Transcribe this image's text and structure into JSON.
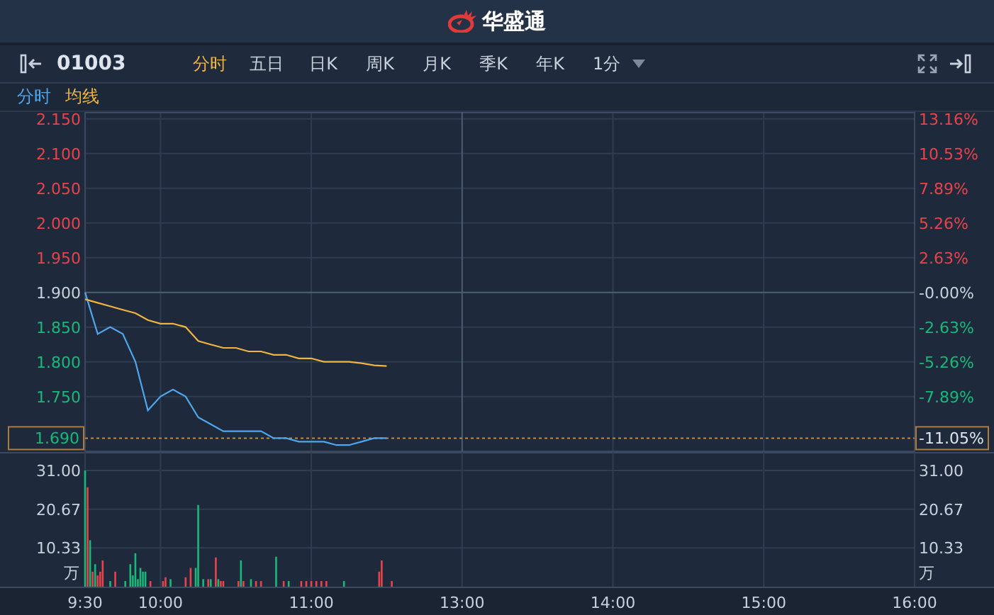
{
  "header": {
    "brand": "华盛通"
  },
  "toolbar": {
    "code": "01003",
    "tabs": [
      {
        "label": "分时",
        "selected": true
      },
      {
        "label": "五日",
        "selected": false
      },
      {
        "label": "日K",
        "selected": false
      },
      {
        "label": "周K",
        "selected": false
      },
      {
        "label": "月K",
        "selected": false
      },
      {
        "label": "季K",
        "selected": false
      },
      {
        "label": "年K",
        "selected": false
      }
    ],
    "interval": "1分"
  },
  "price_chart": {
    "chart_data": {
      "type": "line",
      "grid": true,
      "categories": [
        null,
        null,
        null,
        null,
        null,
        null,
        null,
        null,
        null,
        null,
        null,
        null,
        null,
        null,
        null,
        null,
        null,
        null,
        null,
        null,
        null,
        null,
        null,
        null,
        null,
        null,
        null,
        null,
        null,
        null,
        null,
        null,
        null,
        null,
        null,
        null,
        null,
        null,
        null,
        null,
        null,
        null,
        null,
        null,
        null,
        null,
        null,
        null,
        null,
        null,
        null,
        null,
        null,
        null,
        null,
        null,
        null,
        null,
        null,
        null,
        null,
        null,
        null,
        null,
        null,
        null,
        null
      ],
      "ylim": [
        1.67,
        2.16
      ],
      "yticks": [
        {
          "value": 2.15,
          "label": "2.150"
        },
        {
          "value": 2.1,
          "label": "2.100"
        },
        {
          "value": 2.05,
          "label": "2.050"
        },
        {
          "value": 2.0,
          "label": "2.000"
        },
        {
          "value": 1.95,
          "label": "1.950"
        },
        {
          "value": 1.9,
          "label": "1.900"
        },
        {
          "value": 1.85,
          "label": "1.850"
        },
        {
          "value": 1.8,
          "label": "1.800"
        },
        {
          "value": 1.75,
          "label": "1.750"
        }
      ],
      "ref_lines": [
        {
          "axis": "y",
          "value": 1.9
        },
        {
          "axis": "y",
          "value": 1.69
        }
      ],
      "series": [
        {
          "name": "分时",
          "color": "#4ea6ec",
          "values": [
            1.9,
            1.84,
            1.85,
            1.84,
            1.8,
            1.73,
            1.75,
            1.76,
            1.75,
            1.72,
            1.71,
            1.7,
            1.7,
            1.7,
            1.7,
            1.69,
            1.69,
            1.685,
            1.685,
            1.685,
            1.68,
            1.68,
            1.685,
            1.69,
            1.69,
            null,
            null,
            null,
            null,
            null,
            null,
            null,
            null,
            null,
            null,
            null,
            null,
            null,
            null,
            null,
            null,
            null,
            null,
            null,
            null,
            null,
            null,
            null,
            null,
            null,
            null,
            null,
            null,
            null,
            null,
            null,
            null,
            null,
            null,
            null,
            null,
            null,
            null,
            null,
            null,
            null,
            null
          ]
        },
        {
          "name": "均线",
          "color": "#f2b441",
          "values": [
            1.89,
            1.885,
            1.88,
            1.875,
            1.87,
            1.86,
            1.855,
            1.855,
            1.85,
            1.83,
            1.825,
            1.82,
            1.82,
            1.815,
            1.815,
            1.81,
            1.81,
            1.805,
            1.805,
            1.8,
            1.8,
            1.8,
            1.798,
            1.795,
            1.794,
            null,
            null,
            null,
            null,
            null,
            null,
            null,
            null,
            null,
            null,
            null,
            null,
            null,
            null,
            null,
            null,
            null,
            null,
            null,
            null,
            null,
            null,
            null,
            null,
            null,
            null,
            null,
            null,
            null,
            null,
            null,
            null,
            null,
            null,
            null,
            null,
            null,
            null,
            null,
            null,
            null,
            null
          ]
        }
      ]
    },
    "right_axis": [
      {
        "label": "13.16%",
        "color": "#e8434b"
      },
      {
        "label": "10.53%",
        "color": "#e8434b"
      },
      {
        "label": "7.89%",
        "color": "#e8434b"
      },
      {
        "label": "5.26%",
        "color": "#e8434b"
      },
      {
        "label": "2.63%",
        "color": "#e8434b"
      },
      {
        "label": "-0.00%",
        "color": "#c8d0dc"
      },
      {
        "label": "-2.63%",
        "color": "#19b87a"
      },
      {
        "label": "-5.26%",
        "color": "#19b87a"
      },
      {
        "label": "-7.89%",
        "color": "#19b87a"
      }
    ],
    "current": {
      "price": "1.690",
      "change": "-11.05%",
      "color": "#19b87a"
    }
  },
  "volume_chart": {
    "chart_data": {
      "type": "bar",
      "grid": true,
      "stacked": true,
      "ylabel": "万",
      "ylim": [
        0,
        31
      ],
      "categories": [
        "9:30",
        null,
        null,
        null,
        null,
        null,
        null,
        null,
        null,
        null,
        null,
        null,
        null,
        null,
        null,
        null,
        null,
        null,
        null,
        null,
        null,
        null,
        null,
        null,
        null,
        null,
        null,
        null,
        null,
        null,
        "10:00",
        null,
        null,
        null,
        null,
        null,
        null,
        null,
        null,
        null,
        null,
        null,
        null,
        null,
        null,
        null,
        null,
        null,
        null,
        null,
        null,
        null,
        null,
        null,
        null,
        null,
        null,
        null,
        null,
        null,
        null,
        null,
        null,
        null,
        null,
        null,
        null,
        null,
        null,
        null,
        null,
        null,
        null,
        null,
        null,
        null,
        null,
        null,
        null,
        null,
        null,
        null,
        null,
        null,
        null,
        null,
        null,
        null,
        null,
        null,
        "11:00",
        null,
        null,
        null,
        null,
        null,
        null,
        null,
        null,
        null,
        null,
        null,
        null,
        null,
        null,
        null,
        null,
        null,
        null,
        null,
        null,
        null,
        null,
        null,
        null,
        null,
        null,
        null,
        null,
        null,
        null,
        null,
        null,
        null,
        null,
        null,
        null,
        null,
        null,
        null,
        null,
        null,
        null,
        null,
        null,
        null,
        null,
        null,
        null,
        null,
        null,
        null,
        null,
        null,
        null,
        null,
        null,
        null,
        null,
        null,
        "13:00",
        null,
        null,
        null,
        null,
        null,
        null,
        null,
        null,
        null,
        null,
        null,
        null,
        null,
        null,
        null,
        null,
        null,
        null,
        null,
        null,
        null,
        null,
        null,
        null,
        null,
        null,
        null,
        null,
        null,
        null,
        null,
        null,
        null,
        null,
        null,
        null,
        null,
        null,
        null,
        null,
        null,
        null,
        null,
        null,
        null,
        null,
        null,
        null,
        null,
        null,
        null,
        null,
        null,
        null,
        null,
        null,
        null,
        null,
        null,
        "14:00",
        null,
        null,
        null,
        null,
        null,
        null,
        null,
        null,
        null,
        null,
        null,
        null,
        null,
        null,
        null,
        null,
        null,
        null,
        null,
        null,
        null,
        null,
        null,
        null,
        null,
        null,
        null,
        null,
        null,
        null,
        null,
        null,
        null,
        null,
        null,
        null,
        null,
        null,
        null,
        null,
        null,
        null,
        null,
        null,
        null,
        null,
        null,
        null,
        null,
        null,
        null,
        null,
        null,
        null,
        null,
        null,
        null,
        null,
        null,
        "15:00",
        null,
        null,
        null,
        null,
        null,
        null,
        null,
        null,
        null,
        null,
        null,
        null,
        null,
        null,
        null,
        null,
        null,
        null,
        null,
        null,
        null,
        null,
        null,
        null,
        null,
        null,
        null,
        null,
        null,
        null,
        null,
        null,
        null,
        null,
        null,
        null,
        null,
        null,
        null,
        null,
        null,
        null,
        null,
        null,
        null,
        null,
        null,
        null,
        null,
        null,
        null,
        null,
        null,
        null,
        null,
        null,
        null,
        null,
        null,
        "16:00"
      ],
      "yticks": [
        {
          "value": 31,
          "label": "31.00"
        },
        {
          "value": 20.67,
          "label": "20.67"
        },
        {
          "value": 10.33,
          "label": "10.33"
        }
      ],
      "series": [
        {
          "color": "#e8434b",
          "values": [
            null,
            26.5,
            null,
            4,
            null,
            3,
            4,
            7,
            null,
            null,
            null,
            null,
            4,
            null,
            null,
            null,
            null,
            null,
            null,
            null,
            null,
            null,
            null,
            null,
            null,
            null,
            1.5,
            null,
            null,
            null,
            null,
            1.5,
            2.5,
            null,
            null,
            null,
            null,
            null,
            null,
            null,
            2.5,
            null,
            5,
            null,
            null,
            null,
            null,
            null,
            null,
            2,
            null,
            null,
            7.8,
            null,
            1.5,
            1.5,
            null,
            null,
            null,
            null,
            null,
            1.5,
            null,
            1.5,
            null,
            null,
            null,
            null,
            1.5,
            null,
            1.5,
            null,
            null,
            null,
            null,
            null,
            null,
            null,
            null,
            1.5,
            null,
            null,
            null,
            null,
            null,
            null,
            1.5,
            null,
            1.5,
            null,
            1.5,
            null,
            1.5,
            null,
            1.5,
            null,
            1.5,
            null,
            null,
            null,
            null,
            null,
            null,
            null,
            null,
            null,
            null,
            null,
            null,
            null,
            null,
            null,
            null,
            null,
            null,
            null,
            null,
            4,
            7,
            null,
            null,
            null,
            1.5,
            null,
            null,
            null,
            null,
            null,
            null,
            null,
            null,
            null,
            null,
            null,
            null,
            null,
            null,
            null,
            null,
            null,
            null,
            null,
            null,
            null,
            null,
            null,
            null,
            null,
            null,
            null,
            null,
            null,
            null,
            null,
            null,
            null,
            null,
            null,
            null,
            null,
            null,
            null,
            null,
            null,
            null,
            null,
            null,
            null,
            null,
            null,
            null,
            null,
            null,
            null,
            null,
            null,
            null,
            null,
            null,
            null,
            null,
            null,
            null,
            null,
            null,
            null,
            null,
            null,
            null,
            null,
            null,
            null,
            null,
            null,
            null,
            null,
            null,
            null,
            null,
            null,
            null,
            null,
            null,
            null,
            null,
            null,
            null,
            null,
            null,
            null,
            null,
            null,
            null,
            null,
            null,
            null,
            null,
            null,
            null,
            null,
            null,
            null,
            null,
            null,
            null,
            null,
            null,
            null,
            null,
            null,
            null,
            null,
            null,
            null,
            null,
            null,
            null,
            null,
            null,
            null,
            null,
            null,
            null,
            null,
            null,
            null,
            null,
            null,
            null,
            null,
            null,
            null,
            null,
            null,
            null,
            null,
            null,
            null,
            null,
            null,
            null,
            null,
            null,
            null,
            null,
            null,
            null,
            null,
            null,
            null,
            null,
            null,
            null,
            null,
            null,
            null,
            null,
            null,
            null,
            null,
            null,
            null,
            null,
            null,
            null,
            null,
            null,
            null,
            null,
            null,
            null,
            null,
            null,
            null,
            null,
            null,
            null,
            null,
            null,
            null,
            null,
            null,
            null,
            null,
            null,
            null,
            null,
            null,
            null,
            null,
            null,
            null,
            null,
            null,
            null,
            null,
            null,
            null,
            null,
            null,
            null,
            null,
            null,
            null,
            null,
            null,
            null,
            null,
            null,
            null,
            null
          ]
        },
        {
          "color": "#19b87a",
          "values": [
            31,
            null,
            12.4,
            null,
            6,
            null,
            null,
            null,
            null,
            null,
            1.5,
            null,
            null,
            null,
            null,
            null,
            1.5,
            null,
            6,
            3,
            8.9,
            2,
            5,
            4,
            4,
            null,
            null,
            null,
            null,
            null,
            null,
            null,
            null,
            null,
            2,
            null,
            null,
            null,
            null,
            null,
            null,
            null,
            null,
            null,
            5,
            21.8,
            null,
            2,
            null,
            null,
            2,
            null,
            null,
            2,
            null,
            null,
            null,
            null,
            null,
            null,
            null,
            null,
            7,
            null,
            null,
            null,
            2,
            null,
            null,
            null,
            null,
            null,
            null,
            null,
            null,
            null,
            8,
            null,
            null,
            null,
            null,
            1.5,
            null,
            null,
            null,
            null,
            null,
            null,
            null,
            null,
            null,
            null,
            null,
            null,
            null,
            null,
            null,
            null,
            null,
            null,
            null,
            null,
            null,
            1.5,
            null,
            null,
            null,
            null,
            null,
            null,
            null,
            null,
            null,
            null,
            null,
            null,
            null,
            null,
            null,
            null,
            null,
            null,
            null,
            null,
            null,
            null,
            null,
            null,
            null,
            null,
            null,
            null,
            null,
            null,
            null,
            null,
            null,
            null,
            null,
            null,
            null,
            null,
            null,
            null,
            null,
            null,
            null,
            null,
            null,
            null,
            null,
            null,
            null,
            null,
            null,
            null,
            null,
            null,
            null,
            null,
            null,
            null,
            null,
            null,
            null,
            null,
            null,
            null,
            null,
            null,
            null,
            null,
            null,
            null,
            null,
            null,
            null,
            null,
            null,
            null,
            null,
            null,
            null,
            null,
            null,
            null,
            null,
            null,
            null,
            null,
            null,
            null,
            null,
            null,
            null,
            null,
            null,
            null,
            null,
            null,
            null,
            null,
            null,
            null,
            null,
            null,
            null,
            null,
            null,
            null,
            null,
            null,
            null,
            null,
            null,
            null,
            null,
            null,
            null,
            null,
            null,
            null,
            null,
            null,
            null,
            null,
            null,
            null,
            null,
            null,
            null,
            null,
            null,
            null,
            null,
            null,
            null,
            null,
            null,
            null,
            null,
            null,
            null,
            null,
            null,
            null,
            null,
            null,
            null,
            null,
            null,
            null,
            null,
            null,
            null,
            null,
            null,
            null,
            null,
            null,
            null,
            null,
            null,
            null,
            null,
            null,
            null,
            null,
            null,
            null,
            null,
            null,
            null,
            null,
            null,
            null,
            null,
            null,
            null,
            null,
            null,
            null,
            null,
            null,
            null,
            null,
            null,
            null,
            null,
            null,
            null,
            null,
            null,
            null,
            null,
            null,
            null,
            null,
            null,
            null,
            null,
            null,
            null,
            null,
            null,
            null,
            null,
            null,
            null,
            null,
            null,
            null,
            null,
            null,
            null,
            null,
            null,
            null,
            null,
            null,
            null,
            null,
            null,
            null,
            null,
            null,
            null,
            null,
            null,
            null,
            null
          ]
        }
      ]
    },
    "right_axis": [
      "31.00",
      "20.67",
      "10.33"
    ],
    "right_unit": "万"
  }
}
